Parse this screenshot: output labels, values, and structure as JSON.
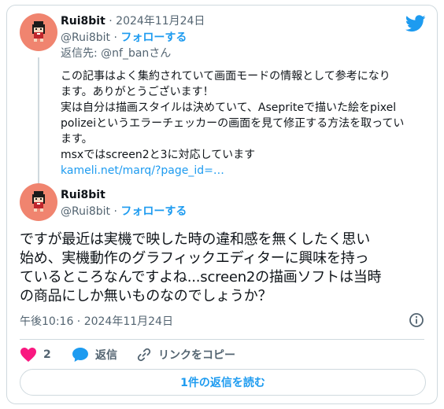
{
  "reply_tweet": {
    "author_name": "Rui8bit",
    "separator": " · ",
    "date": "2024年11月24日",
    "handle": "@Rui8bit",
    "follow_label": "フォローする",
    "reply_to": "返信先: @nf_banさん",
    "lines": [
      "この記事はよく集約されていて画面モードの情報として参考になり",
      "ます。ありがとうございます！",
      "実は自分は描画スタイルは決めていて、Asepriteで描いた絵をpixel",
      "polizeiというエラーチェッカーの画面を見て修正する方法を取ってい",
      "ます。",
      "msxではscreen2と3に対応しています"
    ],
    "link_text": "kameli.net/marq/?page_id=…"
  },
  "main_tweet": {
    "author_name": "Rui8bit",
    "handle": "@Rui8bit",
    "follow_label": "フォローする",
    "text_lines": [
      "ですが最近は実機で映した時の違和感を無くしたく思い",
      "始め、実機動作のグラフィックエディターに興味を持っ",
      "ているところなんですよね...screen2の描画ソフトは当時",
      "の商品にしか無いものなのでしょうか？"
    ],
    "timestamp": "午後10:16 · 2024年11月24日"
  },
  "actions": {
    "like_count": "2",
    "reply_label": "返信",
    "copy_link_label": "リンクをコピー"
  },
  "read_replies_label": "1件の返信を読む",
  "icons": {
    "logo": "twitter-bird-icon",
    "info": "info-icon",
    "like": "heart-icon",
    "reply": "speech-bubble-icon",
    "copy_link": "link-icon"
  },
  "colors": {
    "accent": "#1d9bf0",
    "heart": "#f91880",
    "muted": "#536471",
    "border": "#cfd9de",
    "avatar_bg": "#f0846f"
  }
}
